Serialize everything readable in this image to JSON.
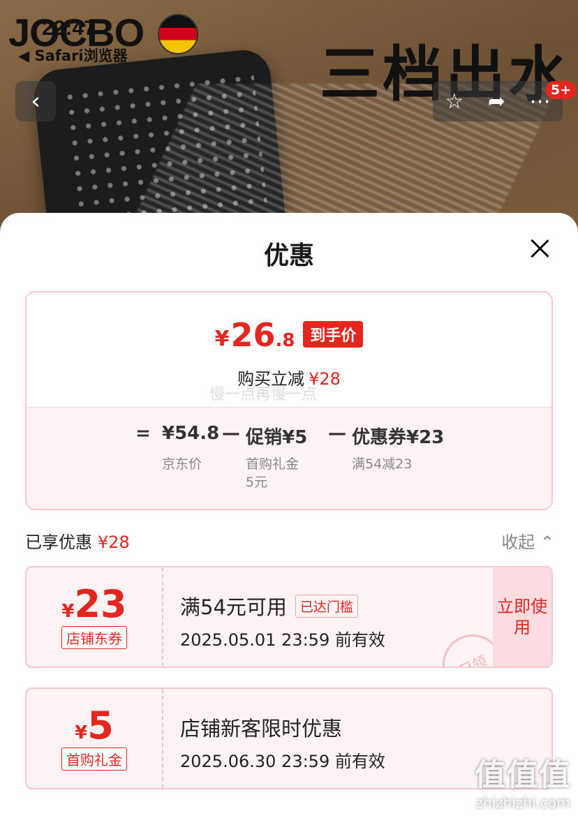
{
  "status": {
    "time": "22:47",
    "back_app": "◀ Safari浏览器"
  },
  "hero": {
    "brand": "JOCBO",
    "promo_text": "三档出水"
  },
  "nav": {
    "badge": "5+"
  },
  "sheet": {
    "title": "优惠",
    "price": {
      "yen": "¥",
      "int": "26",
      "dec": ".8",
      "tag": "到手价"
    },
    "reduce": {
      "label": "购买立减",
      "amount": "¥28"
    },
    "watermark": "慢一点再慢一点",
    "formula": {
      "eq": "=",
      "jd_price": "¥54.8",
      "minus1": "—",
      "promo": "促销¥5",
      "minus2": "—",
      "coupon": "优惠券¥23",
      "jd_label": "京东价",
      "promo_label": "首购礼金\n5元",
      "coupon_label": "满54减23"
    },
    "enjoyed": {
      "label": "已享优惠",
      "amount": "¥28"
    },
    "collapse": "收起 ⌃",
    "coupons": [
      {
        "yen": "¥",
        "amount": "23",
        "tag": "店铺东券",
        "title": "满54元可用",
        "meet_tag": "已达门槛",
        "expire": "2025.05.01 23:59 前有效",
        "use": "立即使用",
        "stamp": "已领"
      },
      {
        "yen": "¥",
        "amount": "5",
        "tag": "首购礼金",
        "title": "店铺新客限时优惠",
        "expire": "2025.06.30 23:59 前有效"
      }
    ]
  },
  "site_mark": {
    "logo": "值值值",
    "url": "zhizhizhi.com"
  }
}
